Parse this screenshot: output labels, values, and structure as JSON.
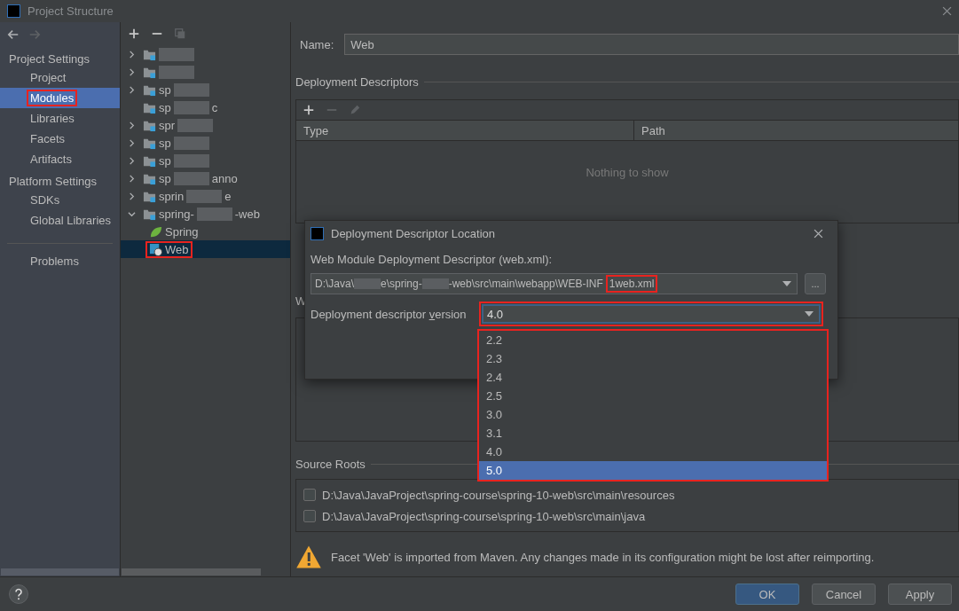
{
  "window": {
    "title": "Project Structure"
  },
  "nav": {
    "sections": [
      {
        "title": "Project Settings",
        "items": [
          {
            "label": "Project",
            "selected": false,
            "highlighted": false
          },
          {
            "label": "Modules",
            "selected": true,
            "highlighted": true
          },
          {
            "label": "Libraries",
            "selected": false,
            "highlighted": false
          },
          {
            "label": "Facets",
            "selected": false,
            "highlighted": false
          },
          {
            "label": "Artifacts",
            "selected": false,
            "highlighted": false
          }
        ]
      },
      {
        "title": "Platform Settings",
        "items": [
          {
            "label": "SDKs",
            "selected": false,
            "highlighted": false
          },
          {
            "label": "Global Libraries",
            "selected": false,
            "highlighted": false
          }
        ]
      }
    ],
    "bottom_items": [
      {
        "label": "Problems",
        "selected": false,
        "highlighted": false
      }
    ]
  },
  "tree": {
    "items": [
      {
        "kind": "module",
        "expanded": false,
        "selected": false,
        "highlighted": false,
        "parts": [
          {
            "kind": "blur"
          }
        ]
      },
      {
        "kind": "module",
        "expanded": false,
        "selected": false,
        "highlighted": false,
        "parts": [
          {
            "kind": "blur"
          }
        ]
      },
      {
        "kind": "module",
        "expanded": false,
        "selected": false,
        "highlighted": false,
        "parts": [
          {
            "kind": "text",
            "text": "sp"
          },
          {
            "kind": "blur"
          }
        ]
      },
      {
        "kind": "module-leaf",
        "selected": false,
        "highlighted": false,
        "parts": [
          {
            "kind": "text",
            "text": "sp"
          },
          {
            "kind": "blur"
          },
          {
            "kind": "text",
            "text": "c"
          }
        ]
      },
      {
        "kind": "module",
        "expanded": false,
        "selected": false,
        "highlighted": false,
        "parts": [
          {
            "kind": "text",
            "text": "spr"
          },
          {
            "kind": "blur"
          }
        ]
      },
      {
        "kind": "module",
        "expanded": false,
        "selected": false,
        "highlighted": false,
        "parts": [
          {
            "kind": "text",
            "text": "sp"
          },
          {
            "kind": "blur"
          }
        ]
      },
      {
        "kind": "module",
        "expanded": false,
        "selected": false,
        "highlighted": false,
        "parts": [
          {
            "kind": "text",
            "text": "sp"
          },
          {
            "kind": "blur"
          }
        ]
      },
      {
        "kind": "module",
        "expanded": false,
        "selected": false,
        "highlighted": false,
        "parts": [
          {
            "kind": "text",
            "text": "sp"
          },
          {
            "kind": "blur"
          },
          {
            "kind": "text",
            "text": "anno"
          }
        ]
      },
      {
        "kind": "module",
        "expanded": false,
        "selected": false,
        "highlighted": false,
        "parts": [
          {
            "kind": "text",
            "text": "sprin"
          },
          {
            "kind": "blur"
          },
          {
            "kind": "text",
            "text": "e"
          }
        ]
      },
      {
        "kind": "module",
        "expanded": true,
        "selected": false,
        "highlighted": false,
        "parts": [
          {
            "kind": "text",
            "text": "spring-"
          },
          {
            "kind": "blur"
          },
          {
            "kind": "text",
            "text": "-web"
          }
        ],
        "children": [
          {
            "kind": "spring",
            "selected": false,
            "highlighted": false,
            "parts": [
              {
                "kind": "text",
                "text": "Spring"
              }
            ]
          },
          {
            "kind": "web",
            "selected": true,
            "highlighted": true,
            "parts": [
              {
                "kind": "text",
                "text": "Web"
              }
            ]
          }
        ]
      }
    ]
  },
  "details": {
    "name_label": "Name:",
    "name_value": "Web",
    "descriptors": {
      "title": "Deployment Descriptors",
      "columns": [
        "Type",
        "Path"
      ],
      "empty_text": "Nothing to show"
    },
    "hidden_section_title": "W",
    "source_roots": {
      "title": "Source Roots",
      "items": [
        {
          "path": "D:\\Java\\JavaProject\\spring-course\\spring-10-web\\src\\main\\resources",
          "checked": false
        },
        {
          "path": "D:\\Java\\JavaProject\\spring-course\\spring-10-web\\src\\main\\java",
          "checked": false
        }
      ]
    },
    "warning": "Facet 'Web' is imported from Maven. Any changes made in its configuration might be lost after reimporting."
  },
  "buttons": [
    {
      "label": "OK",
      "default": true
    },
    {
      "label": "Cancel",
      "default": false
    },
    {
      "label": "Apply",
      "default": false
    }
  ],
  "dialog": {
    "title": "Deployment Descriptor Location",
    "path_label": "Web Module Deployment Descriptor (web.xml):",
    "path_parts": [
      {
        "kind": "text",
        "text": "D:\\Java\\"
      },
      {
        "kind": "blur"
      },
      {
        "kind": "text",
        "text": "e\\spring-"
      },
      {
        "kind": "blur"
      },
      {
        "kind": "text",
        "text": "-web\\src\\main\\webapp\\WEB-INF"
      },
      {
        "kind": "text",
        "text": "1web.xml",
        "highlighted": true
      }
    ],
    "browse_label": "...",
    "version_label_before": "Deployment descriptor ",
    "version_label_mnemonic": "v",
    "version_label_after": "ersion",
    "version_value": "4.0",
    "version_highlighted": true,
    "options": [
      {
        "label": "2.2",
        "selected": false
      },
      {
        "label": "2.3",
        "selected": false
      },
      {
        "label": "2.4",
        "selected": false
      },
      {
        "label": "2.5",
        "selected": false
      },
      {
        "label": "3.0",
        "selected": false
      },
      {
        "label": "3.1",
        "selected": false
      },
      {
        "label": "4.0",
        "selected": false
      },
      {
        "label": "5.0",
        "selected": true
      }
    ]
  }
}
